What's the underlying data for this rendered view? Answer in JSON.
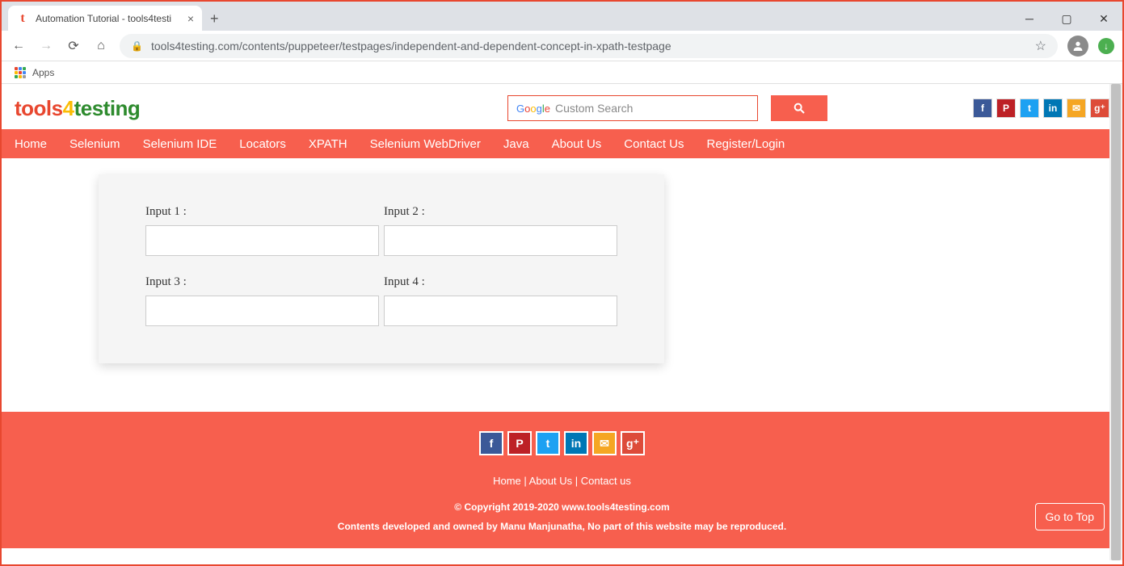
{
  "browser": {
    "tab_title": "Automation Tutorial - tools4testi",
    "url": "tools4testing.com/contents/puppeteer/testpages/independent-and-dependent-concept-in-xpath-testpage",
    "apps_label": "Apps"
  },
  "header": {
    "logo_part1": "tools",
    "logo_bolt": "4",
    "logo_part2": "testing",
    "search_placeholder": "Custom Search"
  },
  "nav": {
    "items": [
      "Home",
      "Selenium",
      "Selenium IDE",
      "Locators",
      "XPATH",
      "Selenium WebDriver",
      "Java",
      "About Us",
      "Contact Us",
      "Register/Login"
    ]
  },
  "form": {
    "labels": [
      "Input 1 :",
      "Input 2 :",
      "Input 3 :",
      "Input 4 :"
    ]
  },
  "footer": {
    "links": [
      "Home",
      "About Us",
      "Contact us"
    ],
    "sep": " | ",
    "copyright": "© Copyright 2019-2020 www.tools4testing.com",
    "disclaimer": "Contents developed and owned by Manu Manjunatha, No part of this website may be reproduced.",
    "goto_top": "Go to Top"
  }
}
